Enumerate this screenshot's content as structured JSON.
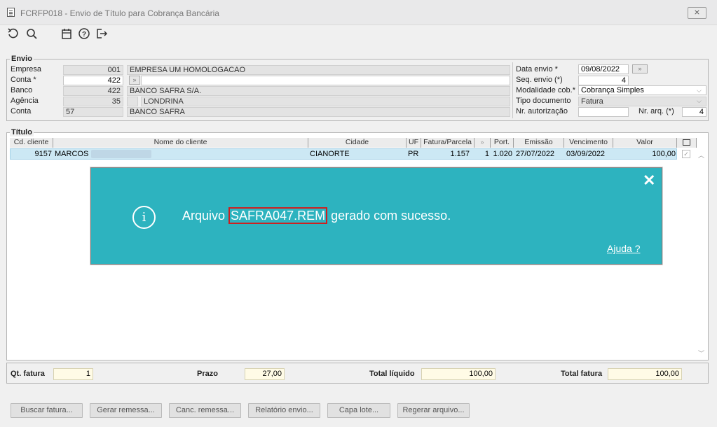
{
  "window": {
    "title": "FCRFP018 - Envio de Título para Cobrança Bancária",
    "close_symbol": "⨯"
  },
  "toolbar": {
    "icons": [
      "undo-icon",
      "search-icon",
      "calendar-icon",
      "help-icon",
      "exit-icon"
    ]
  },
  "envio": {
    "legend": "Envio",
    "empresa": {
      "label": "Empresa",
      "code": "001",
      "name": "EMPRESA UM HOMOLOGACAO"
    },
    "conta": {
      "label": "Conta *",
      "code": "422",
      "name": ""
    },
    "banco": {
      "label": "Banco",
      "code": "422",
      "name": "BANCO SAFRA S/A."
    },
    "agencia": {
      "label": "Agência",
      "code": "35",
      "name": "LONDRINA"
    },
    "conta2": {
      "label": "Conta",
      "code": "57",
      "name": "BANCO SAFRA"
    },
    "data_envio": {
      "label": "Data envio *",
      "value": "09/08/2022"
    },
    "seq_envio": {
      "label": "Seq. envio (*)",
      "value": "4"
    },
    "modalidade": {
      "label": "Modalidade cob.*",
      "value": "Cobrança Simples"
    },
    "tipo_doc": {
      "label": "Tipo documento",
      "value": "Fatura"
    },
    "nr_autorizacao": {
      "label": "Nr. autorização",
      "value": ""
    },
    "nr_arq": {
      "label": "Nr. arq. (*)",
      "value": "4"
    }
  },
  "titulo": {
    "legend": "Título",
    "columns": [
      "Cd. cliente",
      "Nome do cliente",
      "Cidade",
      "UF",
      "Fatura/Parcela",
      "",
      "Port.",
      "Emissão",
      "Vencimento",
      "Valor"
    ],
    "rows": [
      {
        "cd_cliente": "9157",
        "nome": "MARCOS",
        "cidade": "CIANORTE",
        "uf": "PR",
        "fatura": "1.157",
        "parcela": "1",
        "port": "1.020",
        "emissao": "27/07/2022",
        "vencimento": "03/09/2022",
        "valor": "100,00"
      }
    ]
  },
  "dialog": {
    "msg_prefix": "Arquivo",
    "file_name": "SAFRA047.REM",
    "msg_suffix": "gerado com sucesso.",
    "help_link": "Ajuda ?",
    "close_symbol": "✕",
    "info_symbol": "i"
  },
  "totals": {
    "qt_fatura": {
      "label": "Qt. fatura",
      "value": "1"
    },
    "prazo": {
      "label": "Prazo",
      "value": "27,00"
    },
    "total_liquido": {
      "label": "Total líquido",
      "value": "100,00"
    },
    "total_fatura": {
      "label": "Total fatura",
      "value": "100,00"
    }
  },
  "buttons": {
    "buscar": "Buscar fatura...",
    "gerar": "Gerar remessa...",
    "canc": "Canc. remessa...",
    "relatorio": "Relatório envio...",
    "capa": "Capa lote...",
    "regerar": "Regerar arquivo..."
  },
  "colors": {
    "dialog_bg": "#2db3bf",
    "highlight_border": "#cc2020",
    "row_selected": "#cce8f4",
    "total_field": "#fffbe6"
  }
}
